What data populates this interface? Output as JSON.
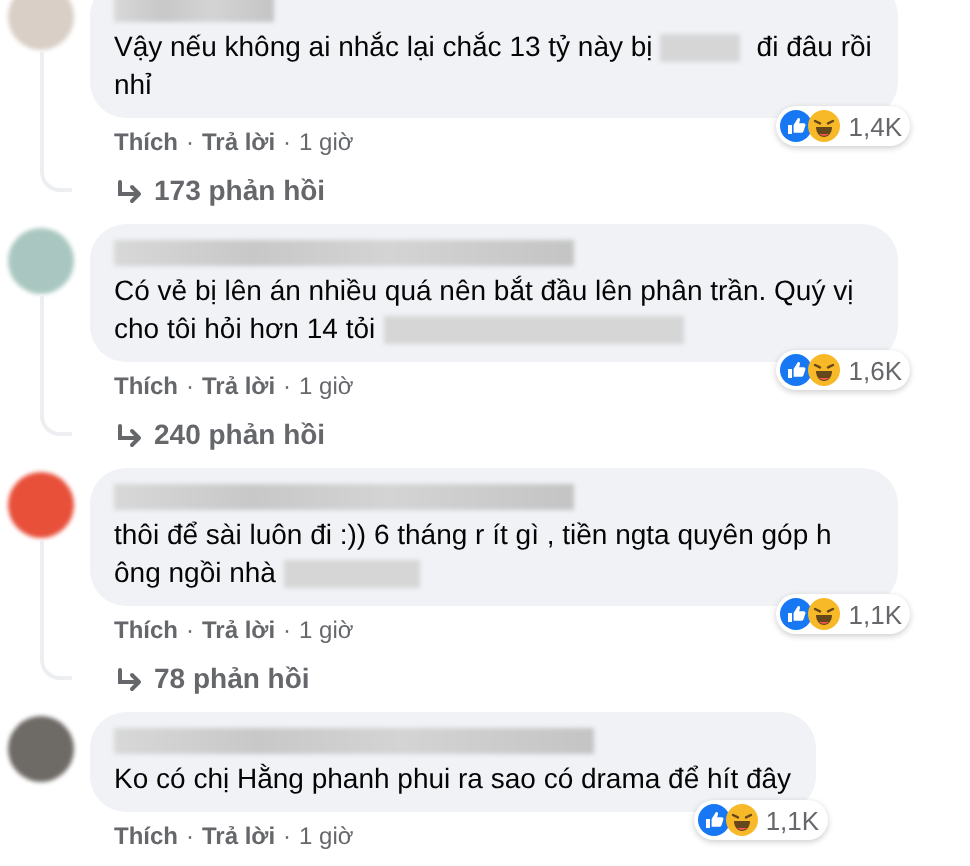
{
  "comments": [
    {
      "avatar": {
        "color": "#d9cfc6"
      },
      "parts": [
        {
          "kind": "text",
          "text": "Vậy nếu không ai nhắc lại chắc 13 tỷ này bị"
        },
        {
          "kind": "redacted"
        },
        {
          "kind": "text",
          "text": "đi đâu rồi nhỉ"
        }
      ],
      "reactions": "1,4K",
      "meta": [
        {
          "kind": "link",
          "text": "Thích"
        },
        {
          "kind": "dot",
          "text": "·"
        },
        {
          "kind": "link",
          "text": "Trả lời"
        },
        {
          "kind": "dot",
          "text": "·"
        },
        {
          "kind": "time",
          "text": "1 giờ"
        }
      ],
      "replies": "173 phản hồi"
    },
    {
      "avatar": {
        "color": "#a9c7c0"
      },
      "parts": [
        {
          "kind": "text",
          "text": "Có vẻ bị lên án nhiều quá nên bắt đầu lên phân trần. Quý vị cho tôi hỏi hơn 14 tỏi"
        },
        {
          "kind": "redacted"
        }
      ],
      "reactions": "1,6K",
      "meta": [
        {
          "kind": "link",
          "text": "Thích"
        },
        {
          "kind": "dot",
          "text": "·"
        },
        {
          "kind": "link",
          "text": "Trả lời"
        },
        {
          "kind": "dot",
          "text": "·"
        },
        {
          "kind": "time",
          "text": "1 giờ"
        }
      ],
      "replies": "240 phản hồi"
    },
    {
      "avatar": {
        "color": "#e8503a"
      },
      "parts": [
        {
          "kind": "text",
          "text": "thôi để sài luôn đi :)) 6 tháng r ít gì , tiền ngta quyên góp h ông ngồi nhà"
        },
        {
          "kind": "redacted"
        }
      ],
      "reactions": "1,1K",
      "meta": [
        {
          "kind": "link",
          "text": "Thích"
        },
        {
          "kind": "dot",
          "text": "·"
        },
        {
          "kind": "link",
          "text": "Trả lời"
        },
        {
          "kind": "dot",
          "text": "·"
        },
        {
          "kind": "time",
          "text": "1 giờ"
        }
      ],
      "replies": "78 phản hồi"
    },
    {
      "avatar": {
        "color": "#6e6a66"
      },
      "parts": [
        {
          "kind": "text",
          "text": "Ko có chị Hằng phanh phui ra sao có drama để hít đây"
        }
      ],
      "reactions": "1,1K",
      "meta": [
        {
          "kind": "link",
          "text": "Thích"
        },
        {
          "kind": "dot",
          "text": "·"
        },
        {
          "kind": "link",
          "text": "Trả lời"
        },
        {
          "kind": "dot",
          "text": "·"
        },
        {
          "kind": "time",
          "text": "1 giờ"
        }
      ]
    }
  ]
}
